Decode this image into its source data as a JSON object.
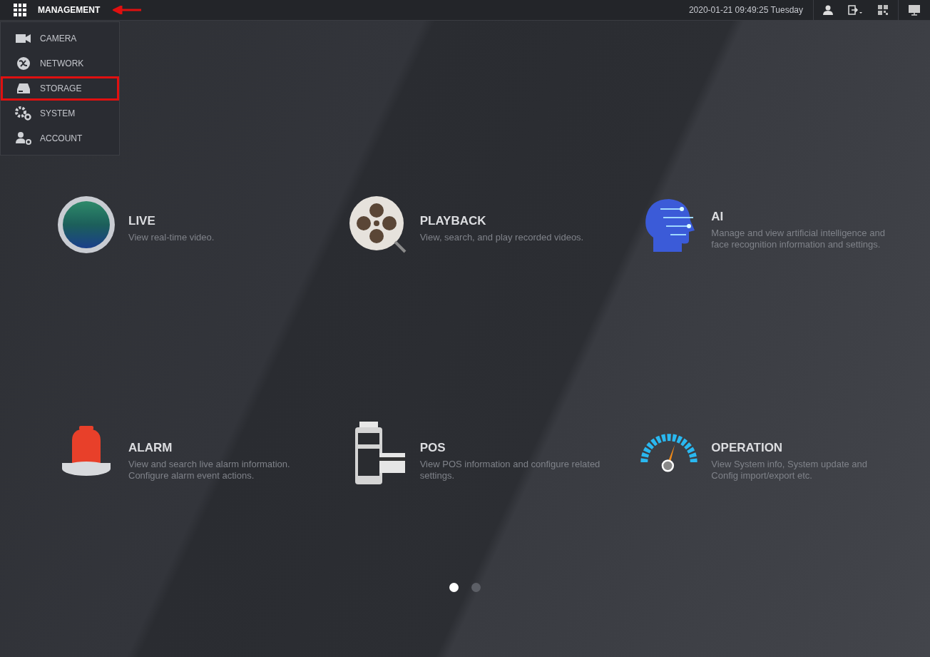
{
  "top_bar": {
    "menu_title": "MANAGEMENT",
    "annotation_arrow": true,
    "datetime": "2020-01-21 09:49:25 Tuesday"
  },
  "menu": [
    {
      "kind": "camera",
      "label": "CAMERA",
      "highlighted": false
    },
    {
      "kind": "network",
      "label": "NETWORK",
      "highlighted": false
    },
    {
      "kind": "storage",
      "label": "STORAGE",
      "highlighted": true
    },
    {
      "kind": "system",
      "label": "SYSTEM",
      "highlighted": false
    },
    {
      "kind": "account",
      "label": "ACCOUNT",
      "highlighted": false
    }
  ],
  "tiles": [
    {
      "kind": "live",
      "title": "LIVE",
      "description": "View real-time video."
    },
    {
      "kind": "playback",
      "title": "PLAYBACK",
      "description": "View, search, and play recorded videos."
    },
    {
      "kind": "ai",
      "title": "AI",
      "description": "Manage and view artificial intelligence and face recognition information and settings."
    },
    {
      "kind": "alarm",
      "title": "ALARM",
      "description": "View and search live alarm information. Configure alarm event actions."
    },
    {
      "kind": "pos",
      "title": "POS",
      "description": "View POS information and configure related settings."
    },
    {
      "kind": "operation",
      "title": "OPERATION",
      "description": "View System info, System update and Config import/export etc."
    }
  ],
  "pages": [
    {
      "selected": true
    },
    {
      "selected": false
    }
  ]
}
